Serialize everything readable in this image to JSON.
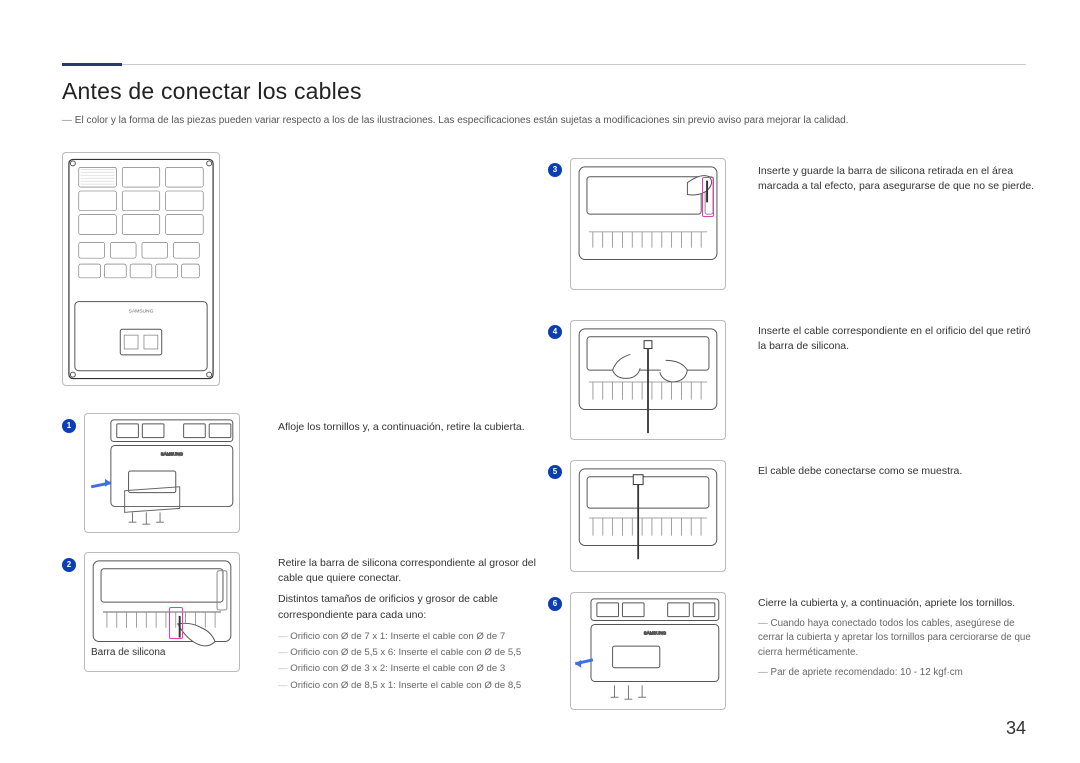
{
  "heading": "Antes de conectar los cables",
  "top_note": "El color y la forma de las piezas pueden variar respecto a los de las ilustraciones. Las especificaciones están sujetas a modificaciones sin previo aviso para mejorar la calidad.",
  "step1": {
    "num": "1",
    "text": "Afloje los tornillos y, a continuación, retire la cubierta."
  },
  "step2": {
    "num": "2",
    "p1": "Retire la barra de silicona correspondiente al grosor del cable que quiere conectar.",
    "p2": "Distintos tamaños de orificios y grosor de cable correspondiente para cada uno:",
    "l1": "Orificio con Ø de 7 x 1: Inserte el cable con Ø de 7",
    "l2": "Orificio con Ø de 5,5 x 6: Inserte el cable con Ø de 5,5",
    "l3": "Orificio con Ø de 3 x 2: Inserte el cable con Ø de 3",
    "l4": "Orificio con Ø de 8,5 x 1: Inserte el cable con Ø de 8,5",
    "caption": "Barra de silicona"
  },
  "step3": {
    "num": "3",
    "text": "Inserte y guarde la barra de silicona retirada en el área marcada a tal efecto, para asegurarse de que no se pierde."
  },
  "step4": {
    "num": "4",
    "text": "Inserte el cable correspondiente en el orificio del que retiró la barra de silicona."
  },
  "step5": {
    "num": "5",
    "text": "El cable debe conectarse como se muestra."
  },
  "step6": {
    "num": "6",
    "text": "Cierre la cubierta y, a continuación, apriete los tornillos.",
    "note1": "Cuando haya conectado todos los cables, asegúrese de cerrar la cubierta y apretar los tornillos para cerciorarse de que cierra herméticamente.",
    "note2": "Par de apriete recomendado: 10 - 12 kgf·cm"
  },
  "page_number": "34",
  "brand": "SAMSUNG"
}
